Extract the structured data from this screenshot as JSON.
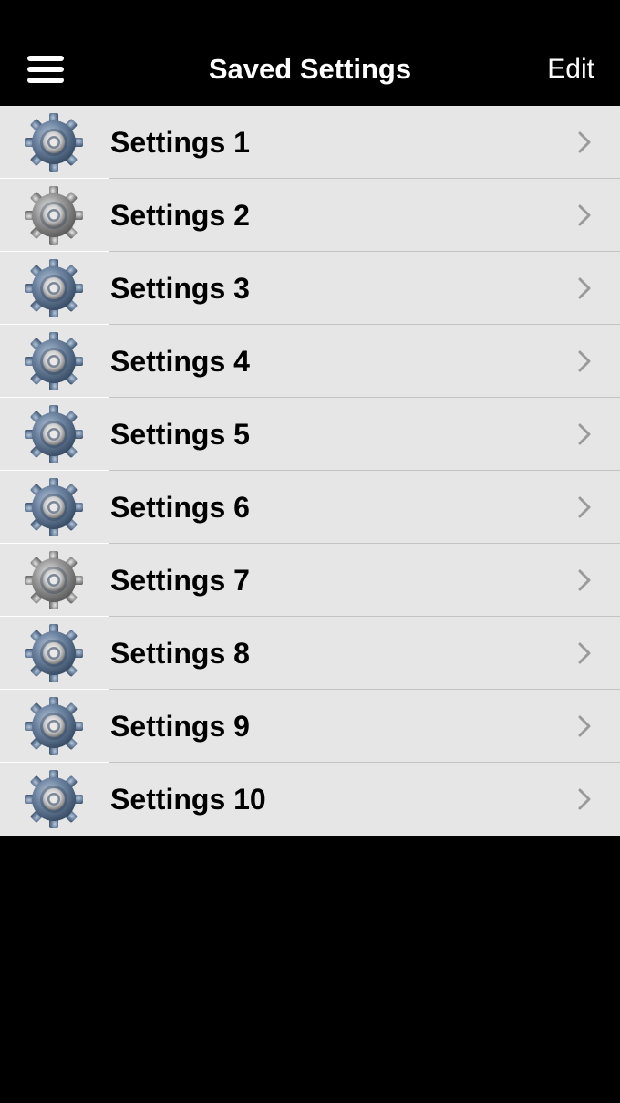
{
  "navbar": {
    "menu_icon": "hamburger-menu-icon",
    "title": "Saved Settings",
    "edit_label": "Edit"
  },
  "colors": {
    "navbar_bg": "#000000",
    "list_bg": "#e6e6e6",
    "separator": "#c3c3c3",
    "chevron": "#9a9a9a",
    "gear_blue": "#5f7590",
    "gear_gray": "#8a8a8a"
  },
  "settings": [
    {
      "label": "Settings 1",
      "icon": "gear-icon",
      "icon_style": "blue"
    },
    {
      "label": "Settings 2",
      "icon": "gear-icon",
      "icon_style": "gray"
    },
    {
      "label": "Settings 3",
      "icon": "gear-icon",
      "icon_style": "blue"
    },
    {
      "label": "Settings 4",
      "icon": "gear-icon",
      "icon_style": "blue"
    },
    {
      "label": "Settings 5",
      "icon": "gear-icon",
      "icon_style": "blue"
    },
    {
      "label": "Settings 6",
      "icon": "gear-icon",
      "icon_style": "blue"
    },
    {
      "label": "Settings 7",
      "icon": "gear-icon",
      "icon_style": "gray"
    },
    {
      "label": "Settings 8",
      "icon": "gear-icon",
      "icon_style": "blue"
    },
    {
      "label": "Settings 9",
      "icon": "gear-icon",
      "icon_style": "blue"
    },
    {
      "label": "Settings 10",
      "icon": "gear-icon",
      "icon_style": "blue"
    }
  ]
}
